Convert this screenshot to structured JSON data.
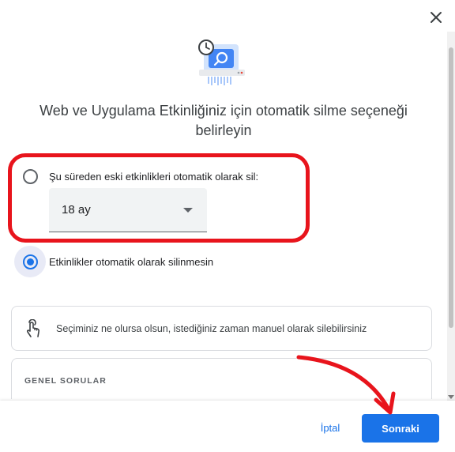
{
  "dialog": {
    "title": "Web ve Uygulama Etkinliğiniz için otomatik silme seçeneği belirleyin"
  },
  "options": {
    "auto_delete_label": "Şu süreden eski etkinlikleri otomatik olarak sil:",
    "auto_delete_selected": false,
    "duration_value": "18 ay",
    "no_delete_label": "Etkinlikler otomatik olarak silinmesin",
    "no_delete_selected": true
  },
  "info": {
    "text": "Seçiminiz ne olursa olsun, istediğiniz zaman manuel olarak silebilirsiniz"
  },
  "faq": {
    "title": "GENEL SORULAR"
  },
  "footer": {
    "cancel_label": "İptal",
    "next_label": "Sonraki"
  },
  "colors": {
    "accent": "#1a73e8",
    "annotation_red": "#e8141c"
  },
  "icons": {
    "close": "close-icon",
    "hero": "clock-shredder-icon",
    "info": "hand-touch-icon",
    "dropdown": "dropdown-arrow-icon"
  }
}
